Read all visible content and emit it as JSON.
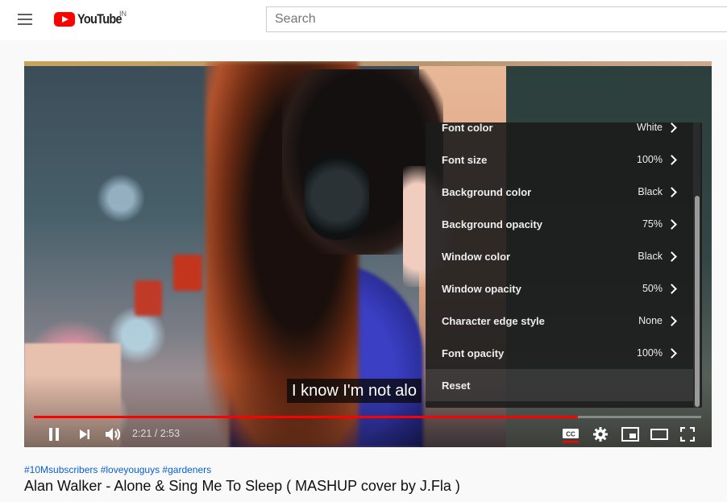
{
  "header": {
    "logo_text": "YouTube",
    "logo_region": "IN",
    "search_placeholder": "Search",
    "search_value": ""
  },
  "player": {
    "subtitle_text": "I know I'm not alo",
    "current_time": "2:21",
    "duration": "2:53",
    "time_display": "2:21 / 2:53",
    "progress_fraction": 0.815,
    "cc_enabled": true,
    "accent_color": "#ff0000"
  },
  "settings_menu": {
    "items": [
      {
        "label": "Font color",
        "value": "White"
      },
      {
        "label": "Font size",
        "value": "100%"
      },
      {
        "label": "Background color",
        "value": "Black"
      },
      {
        "label": "Background opacity",
        "value": "75%"
      },
      {
        "label": "Window color",
        "value": "Black"
      },
      {
        "label": "Window opacity",
        "value": "50%"
      },
      {
        "label": "Character edge style",
        "value": "None"
      },
      {
        "label": "Font opacity",
        "value": "100%"
      }
    ],
    "reset_label": "Reset",
    "highlight_color": "#e00000"
  },
  "video_info": {
    "hashtags": "#10Msubscribers #loveyouguys #gardeners",
    "title": "Alan Walker - Alone & Sing Me To Sleep ( MASHUP cover by J.Fla )",
    "hashtag_color": "#065fd4"
  }
}
